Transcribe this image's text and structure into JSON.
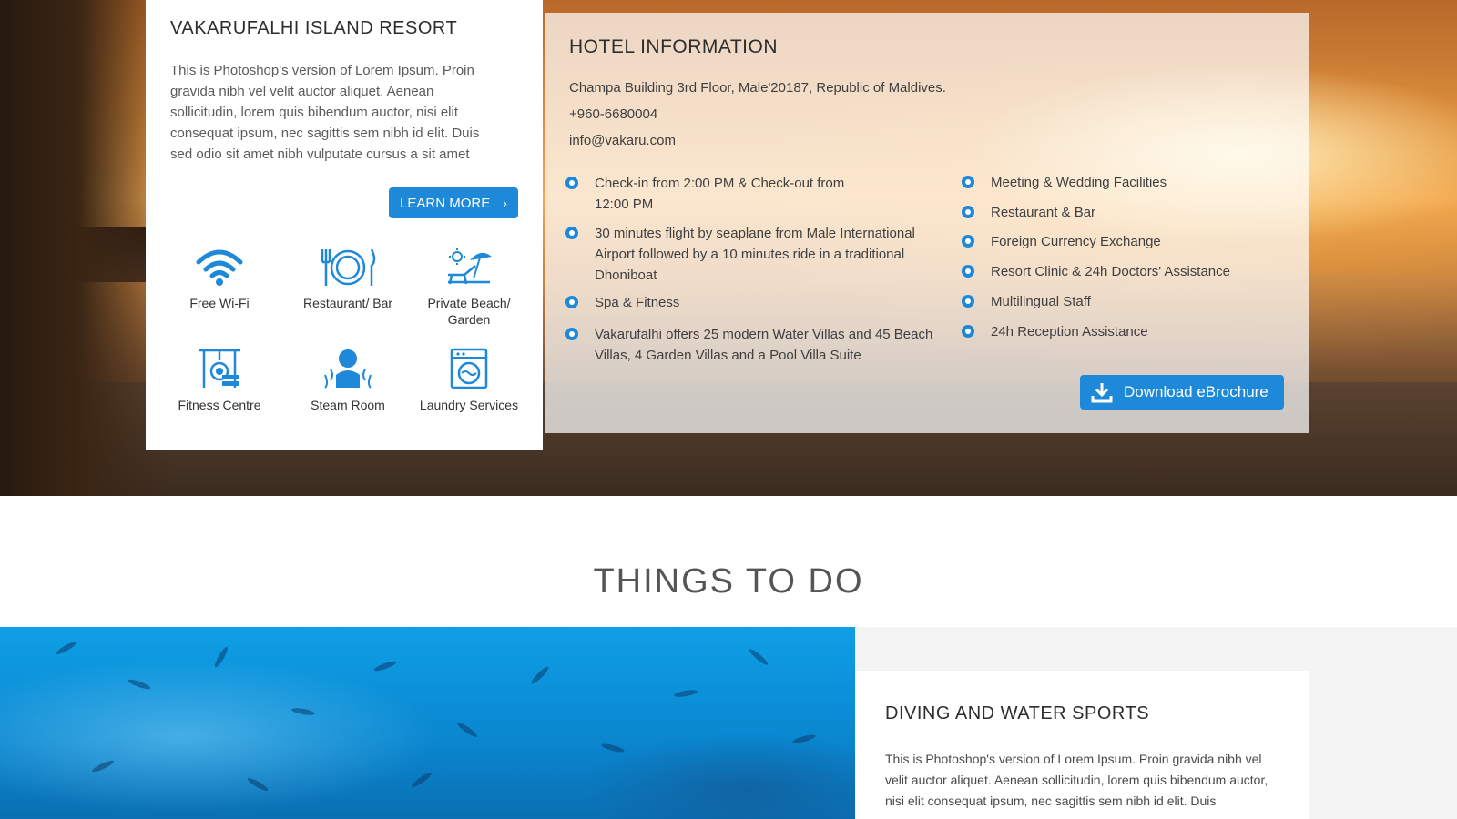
{
  "resort": {
    "title": "VAKARUFALHI ISLAND RESORT",
    "description": "This is Photoshop's version  of Lorem Ipsum. Proin gravida nibh vel velit auctor aliquet. Aenean sollicitudin, lorem quis bibendum auctor, nisi elit consequat ipsum, nec sagittis sem nibh id elit. Duis sed odio sit amet nibh vulputate cursus a sit amet",
    "learn_more": "LEARN MORE",
    "learn_more_icon": "chevron-right-icon",
    "amenities": [
      {
        "label": "Free Wi-Fi",
        "icon": "wifi-icon"
      },
      {
        "label": "Restaurant/ Bar",
        "icon": "plate-cutlery-icon"
      },
      {
        "label": "Private Beach/ Garden",
        "icon": "beach-lounger-icon"
      },
      {
        "label": "Fitness Centre",
        "icon": "weights-icon"
      },
      {
        "label": "Steam Room",
        "icon": "steam-person-icon"
      },
      {
        "label": "Laundry Services",
        "icon": "washing-machine-icon"
      }
    ]
  },
  "hotel_info": {
    "title": "HOTEL INFORMATION",
    "address": "Champa Building 3rd Floor, Male'20187, Republic of Maldives.",
    "phone": "+960-6680004",
    "email": "info@vakaru.com",
    "left_items": [
      "Check-in from 2:00 PM & Check-out from 12:00 PM",
      "30 minutes flight by seaplane from Male International Airport followed by a 10 minutes ride in a traditional Dhoniboat",
      "Spa & Fitness",
      "Vakarufalhi offers 25 modern Water Villas and 45 Beach Villas, 4 Garden Villas and a Pool Villa Suite"
    ],
    "right_items": [
      "Meeting & Wedding Facilities",
      "Restaurant & Bar",
      "Foreign Currency Exchange",
      "Resort Clinic & 24h Doctors' Assistance",
      "Multilingual Staff",
      "24h Reception Assistance"
    ],
    "brochure": "Download eBrochure",
    "brochure_icon": "download-icon"
  },
  "things_to_do": {
    "title": "THINGS TO DO"
  },
  "diving": {
    "title": "DIVING AND WATER SPORTS",
    "description": "This is Photoshop's version  of Lorem Ipsum. Proin gravida nibh vel velit auctor aliquet. Aenean sollicitudin, lorem quis bibendum auctor, nisi elit consequat ipsum, nec sagittis sem nibh id elit. Duis"
  },
  "colors": {
    "accent": "#1e88d9",
    "panel_bg": "#ffffff",
    "section_bg": "#f4f4f4"
  }
}
